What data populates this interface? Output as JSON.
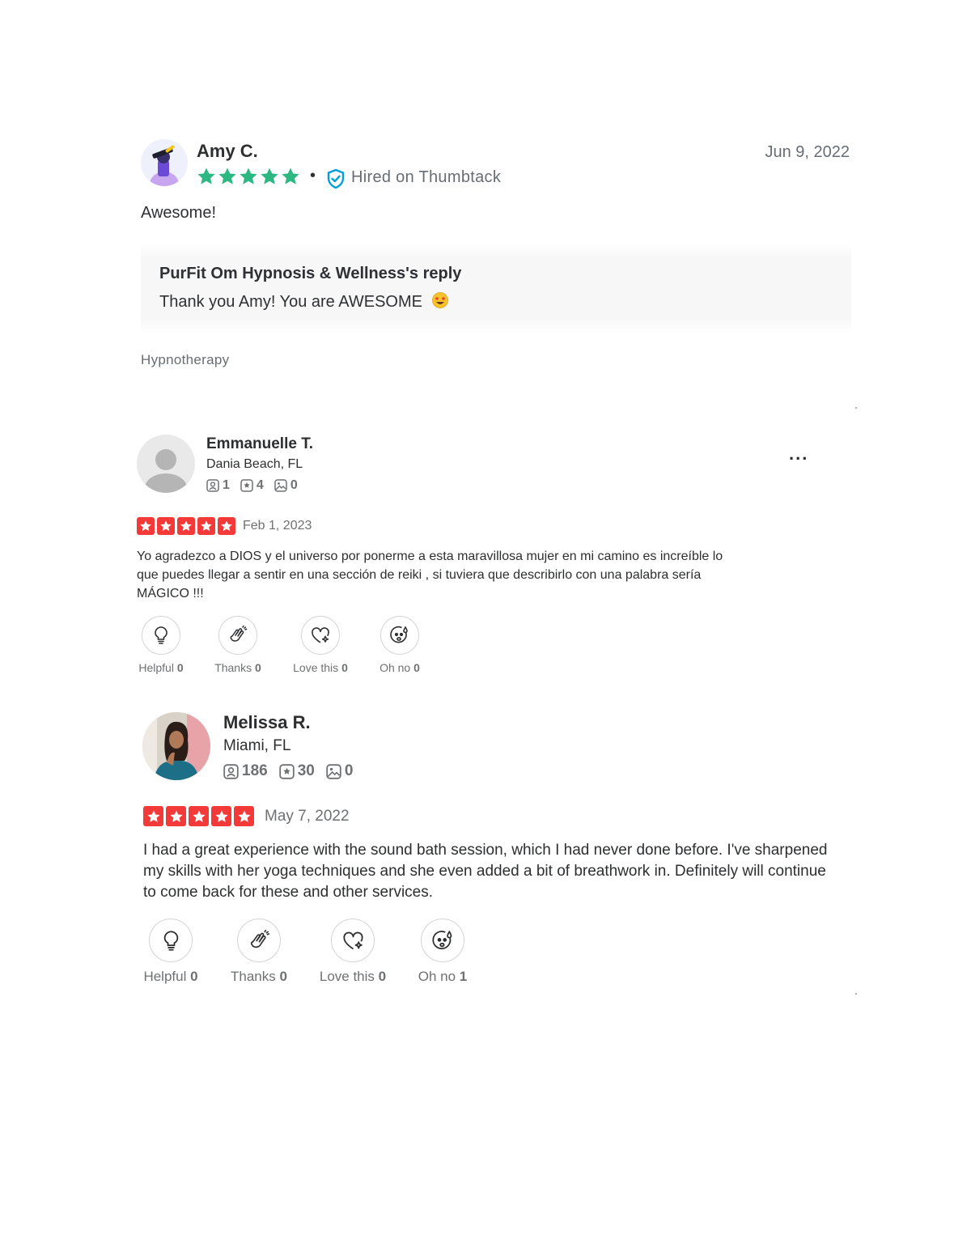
{
  "thumbtack_review": {
    "reviewer_name": "Amy C.",
    "date": "Jun 9, 2022",
    "rating": 5,
    "separator": "•",
    "hired_label": "Hired on Thumbtack",
    "comment": "Awesome!",
    "reply_title": "PurFit Om Hypnosis & Wellness's reply",
    "reply_text": "Thank you Amy! You are AWESOME",
    "service": "Hypnotherapy",
    "star_color": "#2db783",
    "shield_color": "#009fd9"
  },
  "yelp_reviews": [
    {
      "reviewer_name": "Emmanuelle T.",
      "location": "Dania Beach, FL",
      "friends": "1",
      "reviews": "4",
      "photos": "0",
      "more_label": "...",
      "rating": 5,
      "date": "Feb 1, 2023",
      "text": "Yo agradezco a DIOS y el universo por ponerme a esta maravillosa mujer en mi camino es increíble lo que puedes llegar a sentir en una sección de reiki , si tuviera que describirlo con una palabra sería MÁGICO !!!",
      "reactions": [
        {
          "label": "Helpful",
          "count": "0",
          "icon": "lightbulb-icon"
        },
        {
          "label": "Thanks",
          "count": "0",
          "icon": "clapping-hands-icon"
        },
        {
          "label": "Love this",
          "count": "0",
          "icon": "heart-sparkle-icon"
        },
        {
          "label": "Oh no",
          "count": "0",
          "icon": "sad-face-icon"
        }
      ]
    },
    {
      "reviewer_name": "Melissa R.",
      "location": "Miami, FL",
      "friends": "186",
      "reviews": "30",
      "photos": "0",
      "rating": 5,
      "date": "May 7, 2022",
      "text": "I had a great experience with the sound bath session, which I had never done before. I've sharpened my skills with her yoga techniques and she even added a bit of breathwork in. Definitely will continue to come back for these and other services.",
      "reactions": [
        {
          "label": "Helpful",
          "count": "0",
          "icon": "lightbulb-icon"
        },
        {
          "label": "Thanks",
          "count": "0",
          "icon": "clapping-hands-icon"
        },
        {
          "label": "Love this",
          "count": "0",
          "icon": "heart-sparkle-icon"
        },
        {
          "label": "Oh no",
          "count": "1",
          "icon": "sad-face-icon"
        }
      ]
    }
  ],
  "colors": {
    "yelp_red": "#f43939",
    "text": "#2d2e2f",
    "muted": "#6e7072"
  }
}
